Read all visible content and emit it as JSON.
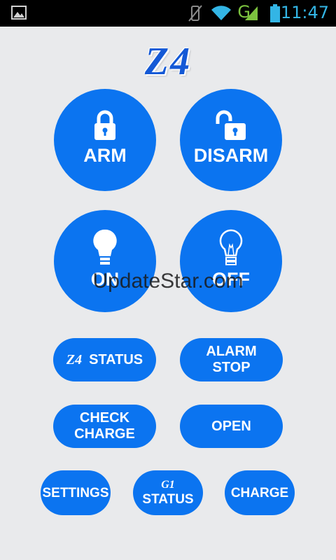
{
  "status_bar": {
    "time": "11:47",
    "network": "G",
    "icons": [
      "gallery-icon",
      "vibrate-off-icon",
      "wifi-icon",
      "signal-icon",
      "battery-icon"
    ]
  },
  "app": {
    "logo_text": "Z4",
    "accent_color": "#0b74f0",
    "background_color": "#e9eaec"
  },
  "buttons": {
    "arm": {
      "label": "ARM",
      "icon": "lock-closed-icon"
    },
    "disarm": {
      "label": "DISARM",
      "icon": "lock-open-icon"
    },
    "on": {
      "label": "ON",
      "icon": "bulb-on-icon"
    },
    "off": {
      "label": "OFF",
      "icon": "bulb-off-icon"
    },
    "z4_status": {
      "prefix": "Z4",
      "label": "STATUS"
    },
    "alarm_stop": {
      "label": "ALARM\nSTOP"
    },
    "check_charge": {
      "label": "CHECK\nCHARGE"
    },
    "open": {
      "label": "OPEN"
    },
    "settings": {
      "label": "SETTINGS"
    },
    "g1_status": {
      "prefix": "G1",
      "label": "STATUS"
    },
    "charge": {
      "label": "CHARGE"
    }
  },
  "watermark": {
    "text": "UpdateStar.com"
  }
}
